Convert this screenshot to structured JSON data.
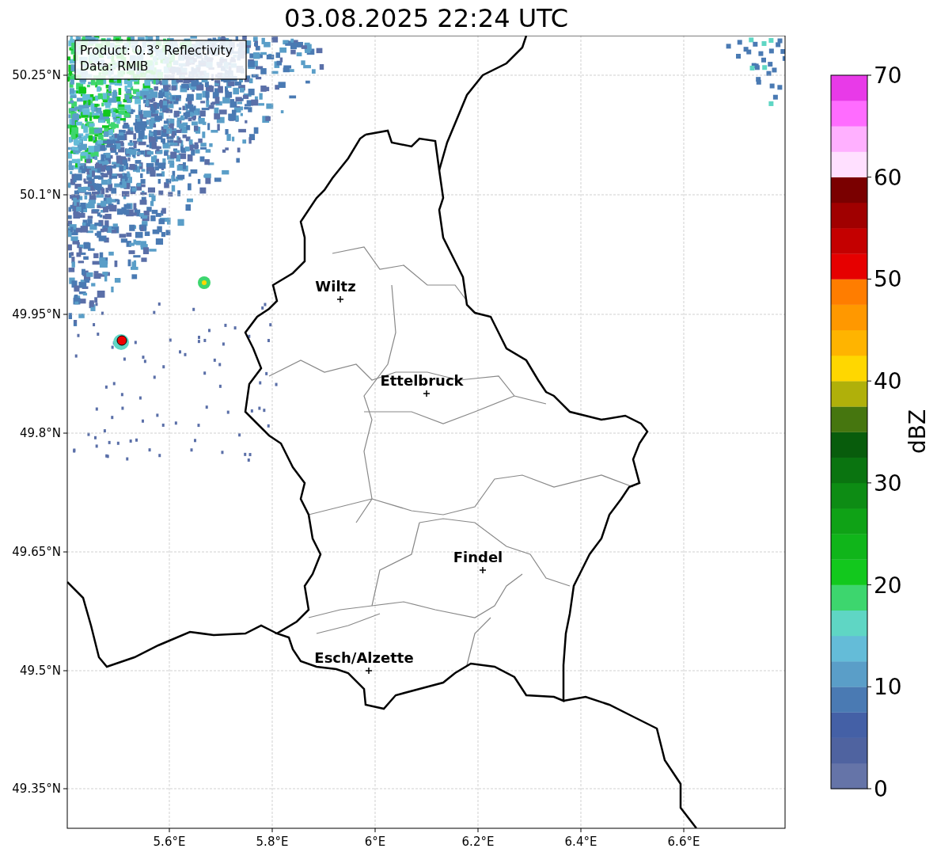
{
  "title": "03.08.2025 22:24 UTC",
  "info_box": [
    "Product: 0.3° Reflectivity",
    "Data: RMIB"
  ],
  "map": {
    "x_ticks": [
      "5.6°E",
      "5.8°E",
      "6°E",
      "6.2°E",
      "6.4°E",
      "6.6°E"
    ],
    "y_ticks": [
      "50.25°N",
      "50.1°N",
      "49.95°N",
      "49.8°N",
      "49.65°N",
      "49.5°N",
      "49.35°N"
    ],
    "cities": [
      {
        "name": "Wiltz"
      },
      {
        "name": "Ettelbruck"
      },
      {
        "name": "Findel"
      },
      {
        "name": "Esch/Alzette"
      }
    ]
  },
  "colorbar": {
    "label": "dBZ",
    "ticks": [
      "70",
      "60",
      "50",
      "40",
      "30",
      "20",
      "10",
      "0"
    ],
    "bins": [
      {
        "color": "#6574a8"
      },
      {
        "color": "#4f63a0"
      },
      {
        "color": "#4460a6"
      },
      {
        "color": "#4a7ab3"
      },
      {
        "color": "#5a9ec8"
      },
      {
        "color": "#64bcd8"
      },
      {
        "color": "#5fd6c4"
      },
      {
        "color": "#3dd66e"
      },
      {
        "color": "#12c81d"
      },
      {
        "color": "#10b51a"
      },
      {
        "color": "#0fa216"
      },
      {
        "color": "#0d8c14"
      },
      {
        "color": "#0a7410"
      },
      {
        "color": "#085c0c"
      },
      {
        "color": "#46760f"
      },
      {
        "color": "#b0b00a"
      },
      {
        "color": "#ffd700"
      },
      {
        "color": "#ffb400"
      },
      {
        "color": "#ff9800"
      },
      {
        "color": "#ff7d00"
      },
      {
        "color": "#e60000"
      },
      {
        "color": "#c40000"
      },
      {
        "color": "#a00000"
      },
      {
        "color": "#7a0000"
      },
      {
        "color": "#ffe0ff"
      },
      {
        "color": "#ffb0ff"
      },
      {
        "color": "#ff6cff"
      },
      {
        "color": "#e83ae8"
      }
    ]
  }
}
